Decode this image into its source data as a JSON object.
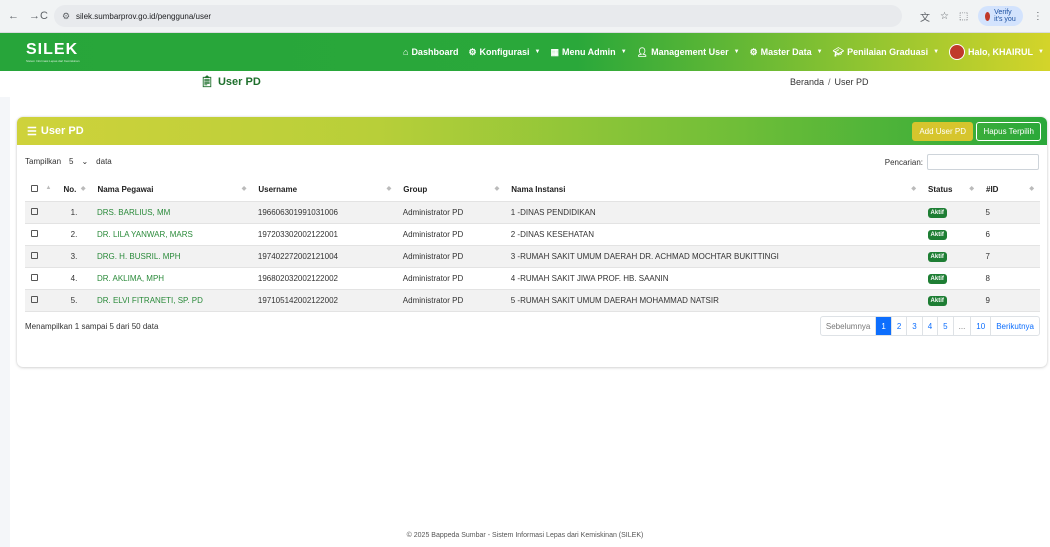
{
  "browser": {
    "url": "silek.sumbarprov.go.id/pengguna/user",
    "verify_label": "Verify it's you"
  },
  "navbar": {
    "brand": "SILEK",
    "brand_sub": "Sistem Informasi Lepas dari Kemiskinan",
    "menu": [
      {
        "icon": "home-icon",
        "label": "Dashboard",
        "caret": false
      },
      {
        "icon": "gears-icon",
        "label": "Konfigurasi",
        "caret": true
      },
      {
        "icon": "table-icon",
        "label": "Menu Admin",
        "caret": true
      },
      {
        "icon": "user-icon",
        "label": "Management User",
        "caret": true
      },
      {
        "icon": "gears-icon",
        "label": "Master Data",
        "caret": true
      },
      {
        "icon": "user-graduate-icon",
        "label": "Penilaian Graduasi",
        "caret": true
      }
    ],
    "user_label": "Halo, KHAIRUL"
  },
  "page": {
    "title": "User PD",
    "breadcrumb": [
      "Beranda",
      "User PD"
    ]
  },
  "card": {
    "title": "User PD",
    "add_button": "Add User PD",
    "delete_button": "Hapus Terpilih",
    "show_prefix": "Tampilkan",
    "page_size": "5",
    "show_suffix": "data",
    "search_label": "Pencarian:",
    "search_value": ""
  },
  "table": {
    "headers": [
      "No.",
      "Nama Pegawai",
      "Username",
      "Group",
      "Nama Instansi",
      "Status",
      "#ID"
    ],
    "rows": [
      {
        "no": "1.",
        "nama": "DRS. BARLIUS, MM",
        "username": "196606301991031006",
        "group": "Administrator PD",
        "instansi": "1 -DINAS PENDIDIKAN",
        "status": "Aktif",
        "id": "5"
      },
      {
        "no": "2.",
        "nama": "DR. LILA YANWAR, MARS",
        "username": "197203302002122001",
        "group": "Administrator PD",
        "instansi": "2 -DINAS KESEHATAN",
        "status": "Aktif",
        "id": "6"
      },
      {
        "no": "3.",
        "nama": "DRG. H. BUSRIL. MPH",
        "username": "197402272002121004",
        "group": "Administrator PD",
        "instansi": "3 -RUMAH SAKIT UMUM DAERAH DR. ACHMAD MOCHTAR BUKITTINGI",
        "status": "Aktif",
        "id": "7"
      },
      {
        "no": "4.",
        "nama": "DR. AKLIMA, MPH",
        "username": "196802032002122002",
        "group": "Administrator PD",
        "instansi": "4 -RUMAH SAKIT JIWA PROF. HB. SAANIN",
        "status": "Aktif",
        "id": "8"
      },
      {
        "no": "5.",
        "nama": "DR. ELVI FITRANETI, SP. PD",
        "username": "197105142002122002",
        "group": "Administrator PD",
        "instansi": "5 -RUMAH SAKIT UMUM DAERAH MOHAMMAD NATSIR",
        "status": "Aktif",
        "id": "9"
      }
    ]
  },
  "pagination": {
    "info": "Menampilkan 1 sampai 5 dari 50 data",
    "prev": "Sebelumnya",
    "pages": [
      "1",
      "2",
      "3",
      "4",
      "5",
      "...",
      "10"
    ],
    "active": "1",
    "next": "Berikutnya"
  },
  "footer": "© 2025 Bappeda Sumbar - Sistem Informasi Lepas dari Kemiskinan (SILEK)"
}
